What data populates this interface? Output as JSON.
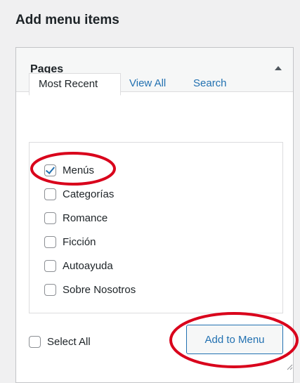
{
  "heading": "Add menu items",
  "panel": {
    "title": "Pages",
    "toggle_icon": "arrow-up-icon"
  },
  "tabs": [
    {
      "label": "Most Recent",
      "active": true
    },
    {
      "label": "View All",
      "active": false
    },
    {
      "label": "Search",
      "active": false
    }
  ],
  "items": [
    {
      "label": "Menús",
      "checked": true
    },
    {
      "label": "Categorías",
      "checked": false
    },
    {
      "label": "Romance",
      "checked": false
    },
    {
      "label": "Ficción",
      "checked": false
    },
    {
      "label": "Autoayuda",
      "checked": false
    },
    {
      "label": "Sobre Nosotros",
      "checked": false
    }
  ],
  "select_all": {
    "label": "Select All",
    "checked": false
  },
  "add_button": {
    "label": "Add to Menu"
  },
  "colors": {
    "accent": "#2271b1",
    "annotation": "#d9001b",
    "panel_header": "#f6f7f7",
    "border": "#dcdcde"
  }
}
